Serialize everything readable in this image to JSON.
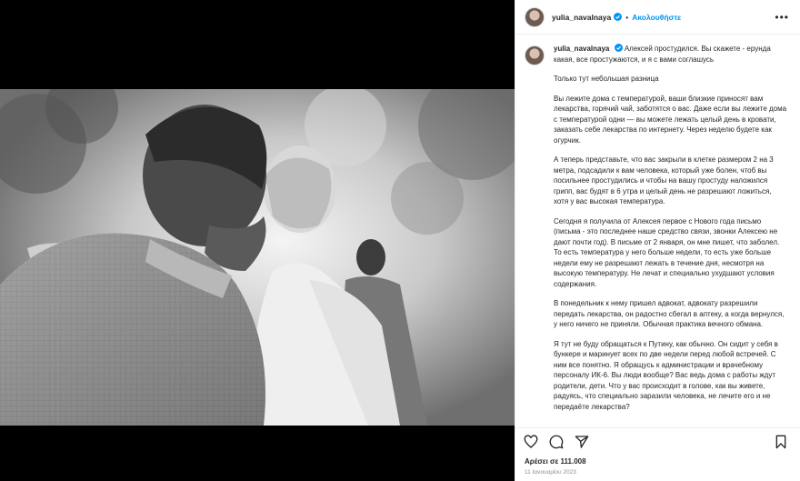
{
  "post": {
    "username": "yulia_navalnaya",
    "follow_label": "Ακολουθήστε",
    "separator": "•",
    "more_label": "•••",
    "caption_intro": "Алексей простудился. Вы скажете - ерунда какая, все простужаются, и я с вами соглашусь",
    "paragraphs": [
      "Только тут небольшая разница",
      "Вы лежите дома с температурой, ваши близкие приносят вам лекарства, горячий чай, заботятся о вас. Даже если вы лежите дома с температурой одни — вы можете лежать целый день в кровати, заказать себе лекарства по интернету. Через неделю будете как огурчик.",
      "А теперь представьте, что вас закрыли в клетке размером 2 на 3 метра, подсадили к вам человека, который уже болен, чтоб вы посильнее простудились и чтобы на вашу простуду наложился грипп, вас будят в 6 утра и целый день не разрешают ложиться, хотя у вас высокая температура.",
      "Сегодня я получила от Алексея первое с Нового года письмо (письма - это последнее наше средство связи, звонки Алексею не дают почти год). В письме от 2 января, он мне пишет, что заболел. То есть температура у него больше недели, то есть уже больше недели ему не разрешают лежать в течение дня, несмотря на высокую температуру. Не лечат и специально ухудшают условия содержания.",
      "В понедельник к нему пришел адвокат, адвокату разрешили передать лекарства, он радостно сбегал в аптеку, а когда вернулся, у него ничего не приняли. Обычная практика вечного обмана.",
      "Я тут не буду обращаться к Путину, как обычно. Он сидит у себя в бункере и маринует всех по две недели перед любой встречей. С ним все понятно. Я обращусь к администрации и врачебному персоналу ИК-6. Вы люди вообще? Вас ведь дома с работы ждут родители, дети. Что у вас происходит в голове, как вы живете, радуясь, что специально заразили человека, не лечите его и не передаёте лекарства?"
    ],
    "likes_text": "Αρέσει σε 111.008",
    "date_text": "11 Ιανουαρίου 2023"
  },
  "icons": {
    "like": "heart-icon",
    "comment": "comment-icon",
    "share": "send-icon",
    "save": "bookmark-icon",
    "verified": "verified-badge-icon",
    "more": "more-options-icon"
  },
  "colors": {
    "accent": "#0095f6",
    "verified": "#0095f6",
    "text": "#262626",
    "muted": "#8e8e8e"
  }
}
